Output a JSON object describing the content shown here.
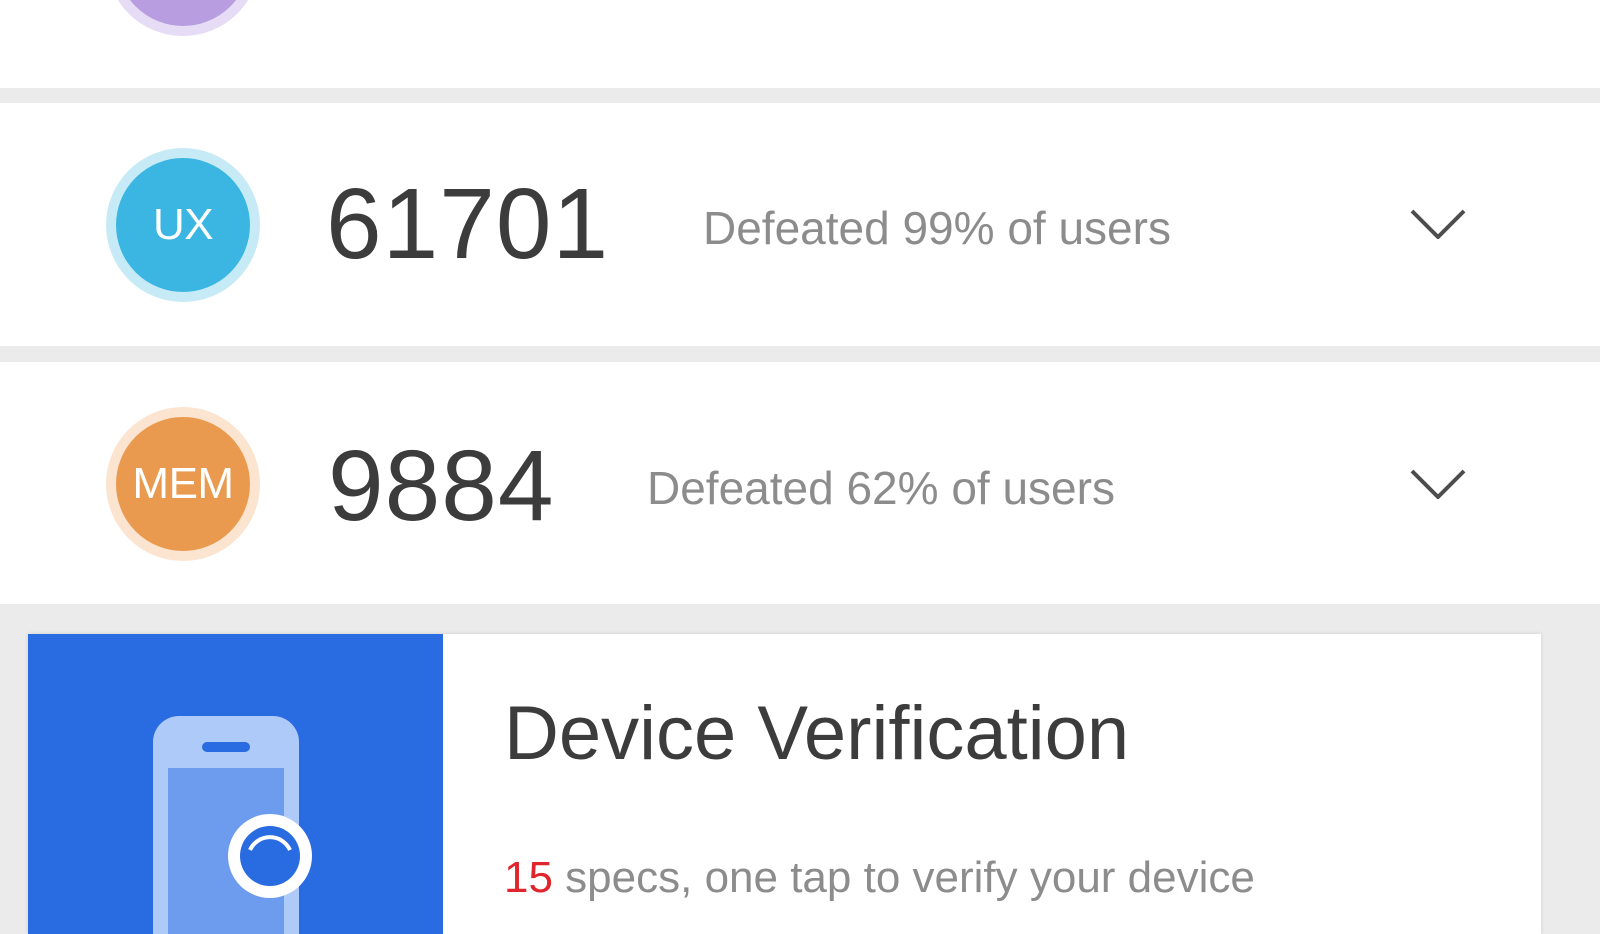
{
  "colors": {
    "background": "#ebebeb",
    "panel": "#ffffff",
    "score_text": "#3c3c3c",
    "rank_text": "#8c8c8c",
    "top_badge": "#b89de0",
    "ux_badge": "#3bb6e2",
    "mem_badge": "#ea9a4f",
    "card_blue": "#296be0",
    "highlight_red": "#e0252c"
  },
  "rows": [
    {
      "badge_label": "",
      "score": "",
      "rank": "",
      "icon": "chevron-down-icon"
    },
    {
      "badge_label": "UX",
      "score": "61701",
      "rank": "Defeated 99% of users",
      "icon": "chevron-down-icon"
    },
    {
      "badge_label": "MEM",
      "score": "9884",
      "rank": "Defeated 62% of users",
      "icon": "chevron-down-icon"
    }
  ],
  "verification_card": {
    "title": "Device Verification",
    "count": "15",
    "subtitle": " specs, one tap to verify your device",
    "icon": "phone-search-icon"
  }
}
